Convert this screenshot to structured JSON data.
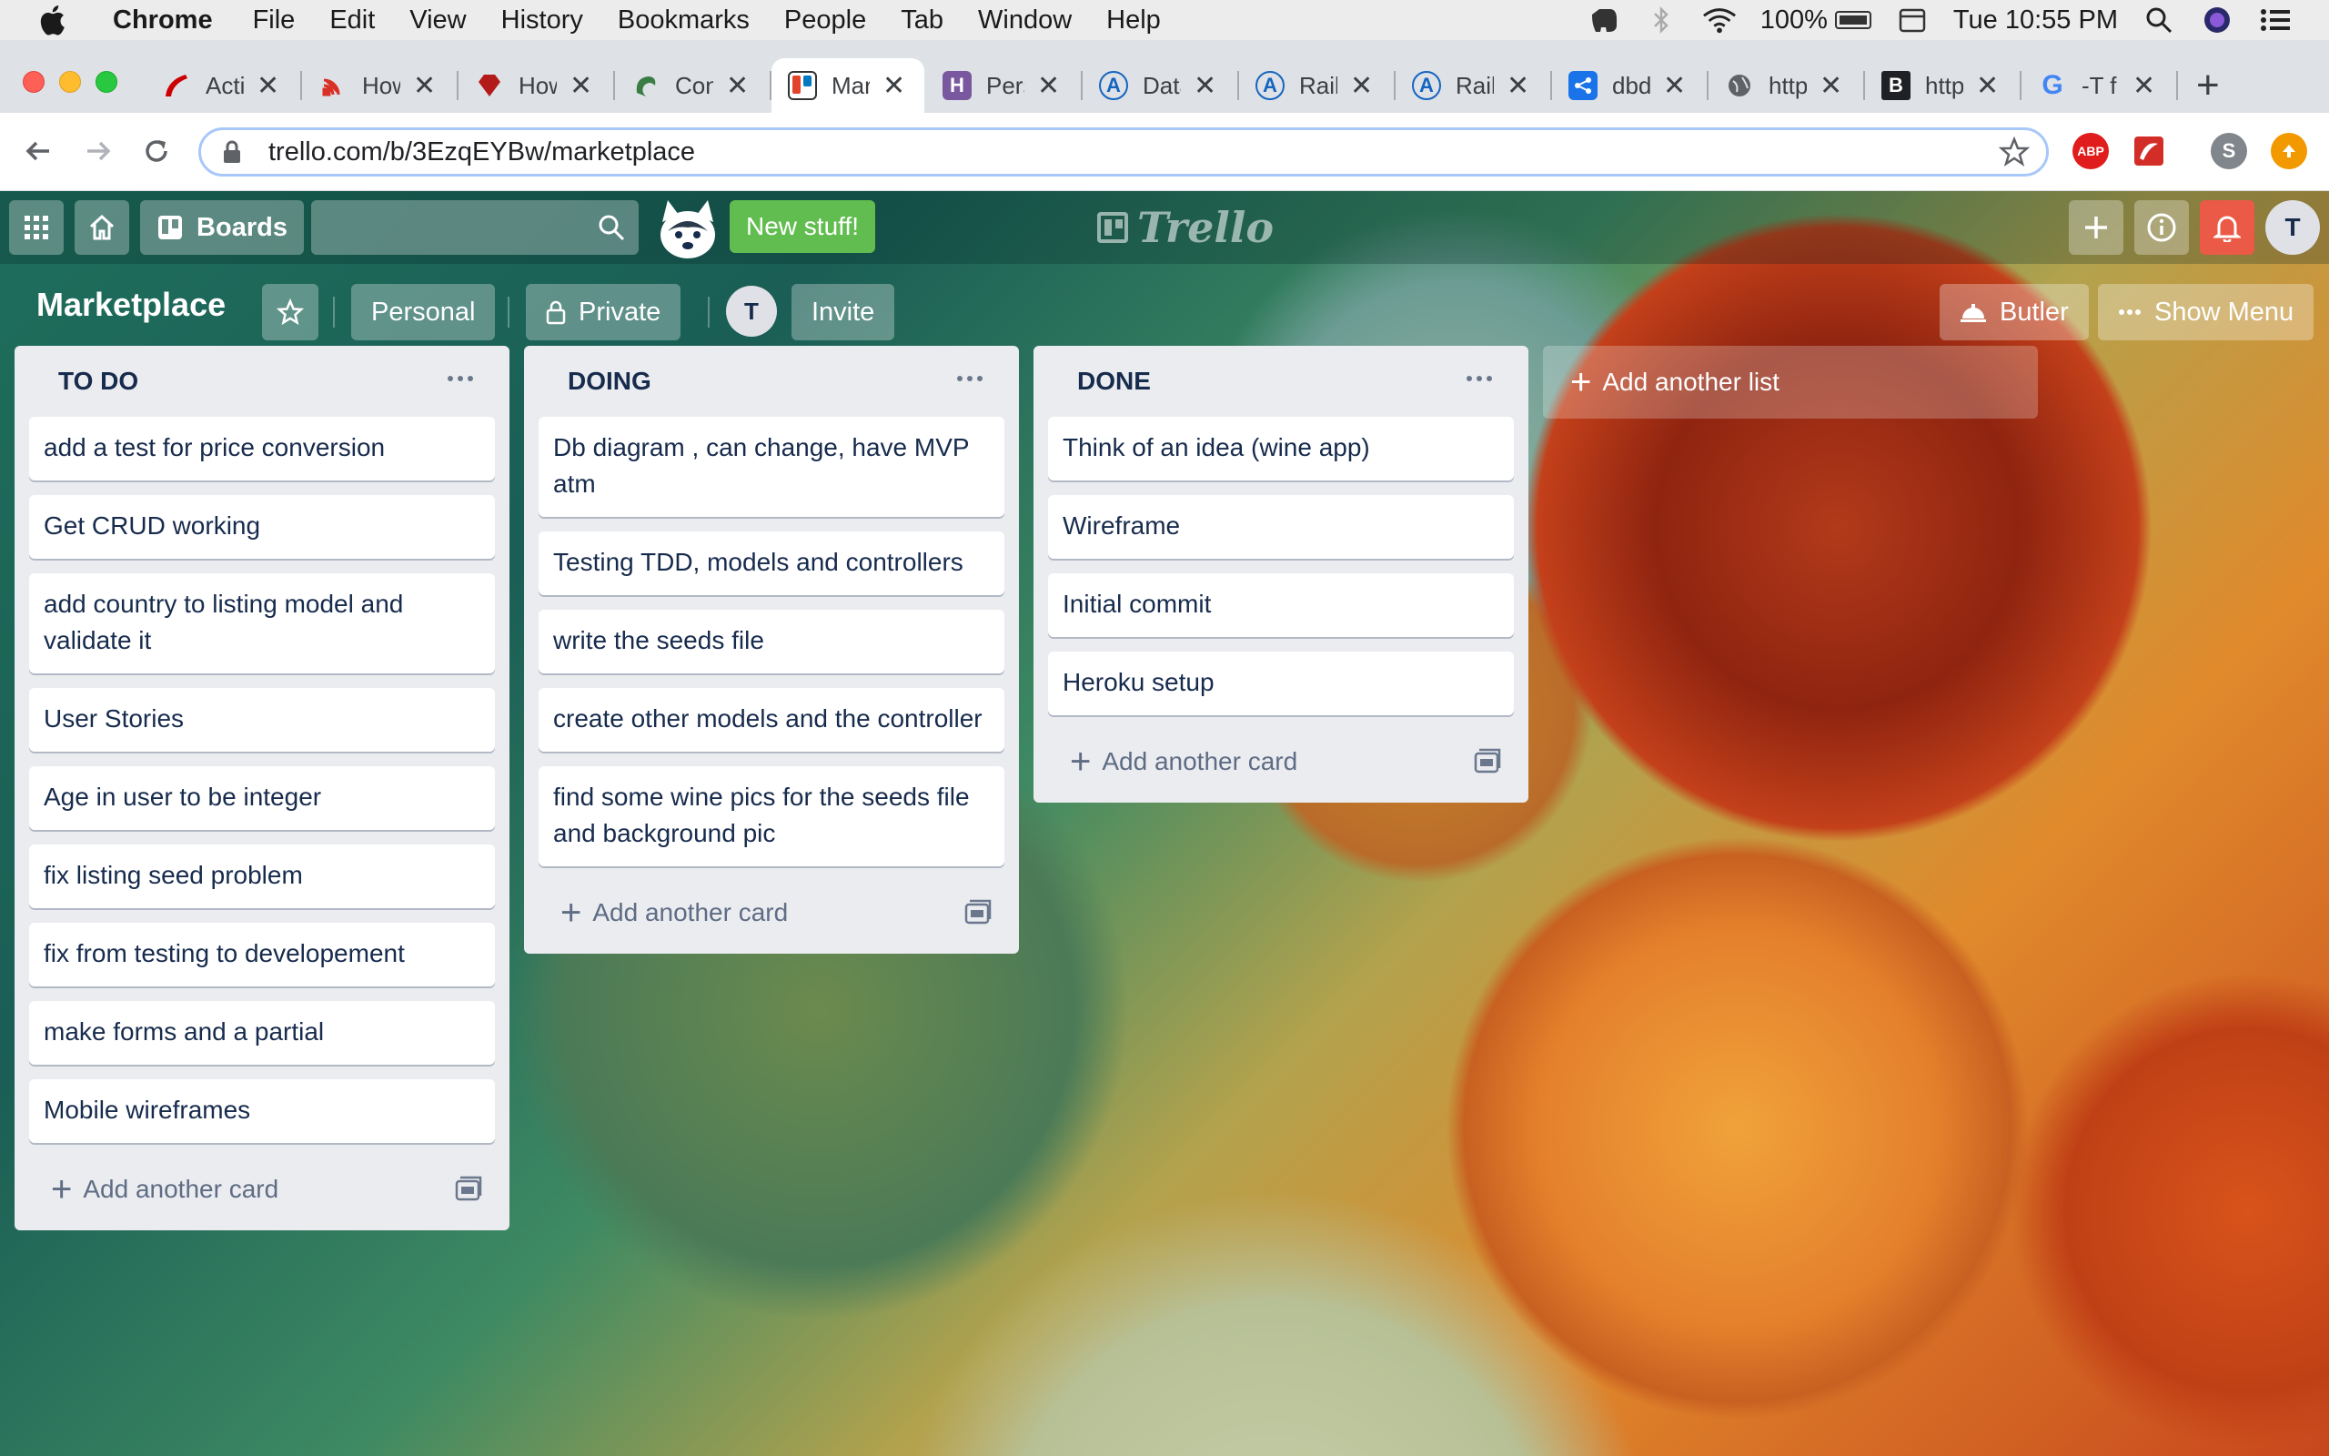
{
  "menubar": {
    "app_name": "Chrome",
    "menus": [
      "File",
      "Edit",
      "View",
      "History",
      "Bookmarks",
      "People",
      "Tab",
      "Window",
      "Help"
    ],
    "battery": "100%",
    "clock": "Tue 10:55 PM"
  },
  "tabs": [
    {
      "title": "Acti",
      "icon": "rails-icon",
      "color": "#cc0000"
    },
    {
      "title": "How",
      "icon": "rss-icon",
      "color": "#d93025"
    },
    {
      "title": "How",
      "icon": "ruby-gem-icon",
      "color": "#b31b1b"
    },
    {
      "title": "Con",
      "icon": "dragon-icon",
      "color": "#3a7d44"
    },
    {
      "title": "Mar",
      "icon": "trello-icon",
      "color": "#0079bf"
    },
    {
      "title": "Pers",
      "icon": "heroku-icon",
      "color": "#79589f"
    },
    {
      "title": "Data",
      "icon": "a-icon",
      "color": "#1565c0"
    },
    {
      "title": "Rail",
      "icon": "a-icon",
      "color": "#1565c0"
    },
    {
      "title": "Rail",
      "icon": "a-icon",
      "color": "#1565c0"
    },
    {
      "title": "dbd",
      "icon": "share-icon",
      "color": "#1a73e8"
    },
    {
      "title": "http",
      "icon": "globe-icon",
      "color": "#5f6368"
    },
    {
      "title": "http",
      "icon": "b-icon",
      "color": "#202124"
    },
    {
      "title": "-T f",
      "icon": "google-icon",
      "color": "#4285f4"
    }
  ],
  "toolbar": {
    "url": "trello.com/b/3EzqEYBw/marketplace",
    "profile_initial": "S"
  },
  "trello_header": {
    "boards_label": "Boards",
    "new_stuff_label": "New stuff!",
    "logo_text": "Trello",
    "avatar_initial": "T"
  },
  "board": {
    "title": "Marketplace",
    "team_label": "Personal",
    "visibility_label": "Private",
    "member_initial": "T",
    "invite_label": "Invite",
    "butler_label": "Butler",
    "show_menu_label": "Show Menu"
  },
  "lists": [
    {
      "name": "TO DO",
      "cards": [
        "add a test for price conversion",
        "Get CRUD working",
        "add country to listing model and validate it",
        "User Stories",
        "Age in user to be integer",
        "fix listing seed problem",
        "fix from testing to developement",
        "make forms and a partial",
        "Mobile wireframes"
      ],
      "add_card_label": "Add another card"
    },
    {
      "name": "DOING",
      "cards": [
        "Db diagram , can change, have MVP atm",
        "Testing TDD, models and controllers",
        "write the seeds file",
        "create other models and the controller",
        "find some wine pics for the seeds file and background pic"
      ],
      "add_card_label": "Add another card"
    },
    {
      "name": "DONE",
      "cards": [
        "Think of an idea (wine app)",
        "Wireframe",
        "Initial commit",
        "Heroku setup"
      ],
      "add_card_label": "Add another card"
    }
  ],
  "add_list_label": "Add another list"
}
